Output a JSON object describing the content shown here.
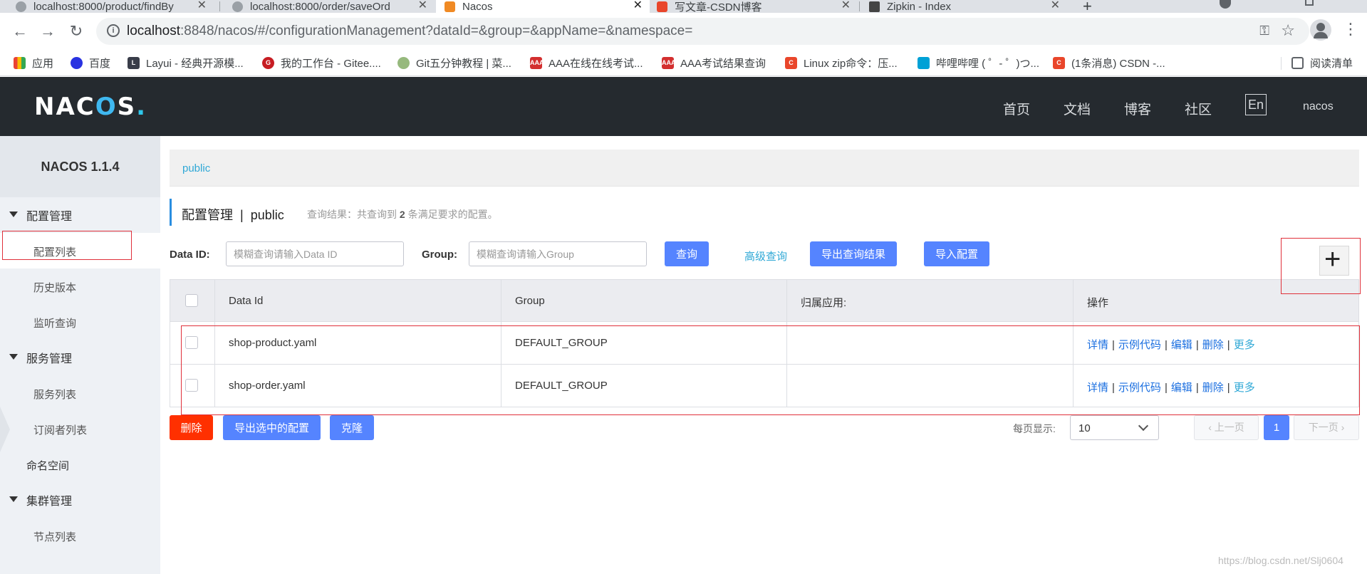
{
  "browser": {
    "tabs": [
      {
        "label": "localhost:8000/product/findBy",
        "active": false
      },
      {
        "label": "localhost:8000/order/saveOrd",
        "active": false
      },
      {
        "label": "Nacos",
        "active": true
      },
      {
        "label": "写文章-CSDN博客",
        "active": false
      },
      {
        "label": "Zipkin - Index",
        "active": false
      }
    ],
    "url_host": "localhost",
    "url_rest": ":8848/nacos/#/configurationManagement?dataId=&group=&appName=&namespace=",
    "bookmarks": [
      {
        "label": "应用",
        "icon": "apps-grid-icon",
        "color": "#4285f4"
      },
      {
        "label": "百度",
        "icon": "baidu-paw-icon",
        "color": "#2932e1"
      },
      {
        "label": "Layui - 经典开源模...",
        "icon": "layui-icon",
        "color": "#393d49"
      },
      {
        "label": "我的工作台 - Gitee....",
        "icon": "gitee-icon",
        "color": "#c71d23"
      },
      {
        "label": "Git五分钟教程 | 菜...",
        "icon": "runoob-icon",
        "color": "#96b97d"
      },
      {
        "label": "AAA在线在线考试...",
        "icon": "aaa-icon",
        "color": "#d32f2f"
      },
      {
        "label": "AAA考试结果查询",
        "icon": "aaa-icon",
        "color": "#d32f2f"
      },
      {
        "label": "Linux zip命令：压...",
        "icon": "csdn-icon",
        "color": "#e9462b"
      },
      {
        "label": "哔哩哔哩 ( ゜- ゜)つ...",
        "icon": "bilibili-icon",
        "color": "#00a1d6"
      },
      {
        "label": "(1条消息) CSDN -...",
        "icon": "csdn-icon",
        "color": "#e9462b"
      }
    ],
    "reading_list": "阅读清单"
  },
  "header": {
    "logo": "NACOS.",
    "nav": [
      "首页",
      "文档",
      "博客",
      "社区"
    ],
    "lang": "En",
    "user": "nacos"
  },
  "sidebar": {
    "version": "NACOS 1.1.4",
    "groups": [
      {
        "label": "配置管理",
        "items": [
          "配置列表",
          "历史版本",
          "监听查询"
        ]
      },
      {
        "label": "服务管理",
        "items": [
          "服务列表",
          "订阅者列表"
        ]
      },
      {
        "label": "命名空间",
        "items": []
      },
      {
        "label": "集群管理",
        "items": [
          "节点列表"
        ]
      }
    ],
    "active_item": "配置列表"
  },
  "main": {
    "namespace_tab": "public",
    "title": "配置管理",
    "title_sep": "|",
    "title_ns": "public",
    "query_prefix": "查询结果：共查询到",
    "query_count": "2",
    "query_suffix": "条满足要求的配置。",
    "search": {
      "dataid_label": "Data ID:",
      "dataid_placeholder": "模糊查询请输入Data ID",
      "group_label": "Group:",
      "group_placeholder": "模糊查询请输入Group",
      "query_btn": "查询",
      "advanced_link": "高级查询",
      "export_btn": "导出查询结果",
      "import_btn": "导入配置"
    },
    "add_icon": "plus-icon",
    "table": {
      "columns": [
        "Data Id",
        "Group",
        "归属应用:",
        "操作"
      ],
      "rows": [
        {
          "data_id": "shop-product.yaml",
          "group": "DEFAULT_GROUP",
          "app": ""
        },
        {
          "data_id": "shop-order.yaml",
          "group": "DEFAULT_GROUP",
          "app": ""
        }
      ],
      "ops": [
        "详情",
        "示例代码",
        "编辑",
        "删除",
        "更多"
      ],
      "ops_sep": "|"
    },
    "bottom": {
      "delete_btn": "删除",
      "export_selected_btn": "导出选中的配置",
      "clone_btn": "克隆",
      "page_size_label": "每页显示:",
      "page_size": "10",
      "prev": "‹ 上一页",
      "current_page": "1",
      "next": "下一页 ›"
    }
  },
  "watermark": "https://blog.csdn.net/Slj0604"
}
